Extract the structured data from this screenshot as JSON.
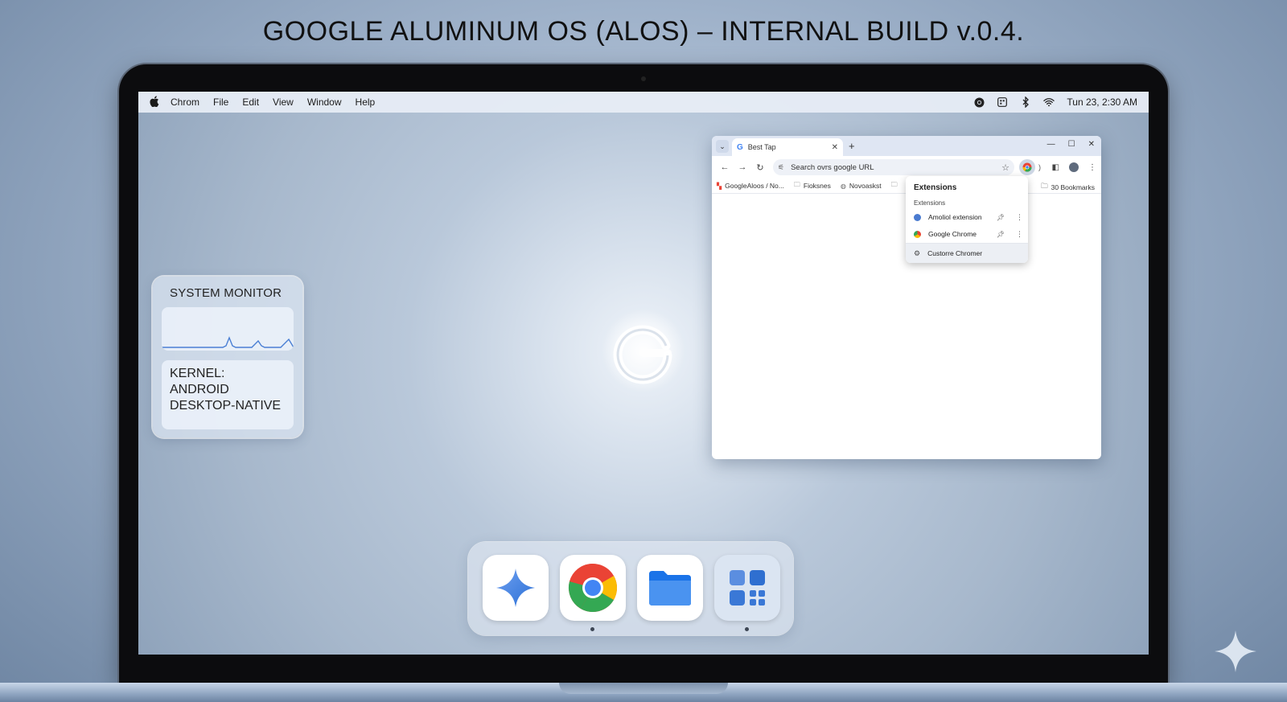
{
  "page": {
    "title": "GOOGLE ALUMINUM OS (ALOS) – INTERNAL BUILD v.0.4."
  },
  "menubar": {
    "app_name": "Chrom",
    "items": [
      "File",
      "Edit",
      "View",
      "Window",
      "Help"
    ],
    "tray_icons": [
      "chrome-icon",
      "grid-square-icon",
      "bluetooth-icon",
      "wifi-icon"
    ],
    "clock": "Tun 23, 2:30 AM"
  },
  "widget": {
    "title": "SYSTEM MONITOR",
    "kernel_lines": [
      "KERNEL:",
      "ANDROID",
      "DESKTOP-NATIVE"
    ]
  },
  "browser": {
    "tab_title": "Best Tap",
    "omnibox_text": "Search ovrs google URL",
    "bookmarks": [
      {
        "label": "GoogleAloos / No...",
        "icon": "google-favicon-icon"
      },
      {
        "label": "Fioksnes",
        "icon": "folder-icon"
      },
      {
        "label": "Novoaskst",
        "icon": "globe-icon"
      }
    ],
    "all_bookmarks": "30 Bookmarks",
    "extensions_popup": {
      "title": "Extensions",
      "subtitle": "Extensions",
      "items": [
        {
          "label": "Amoliol extension",
          "icon_color": "#4a7bd0"
        },
        {
          "label": "Google Chrome",
          "icon_color": "#e94235"
        }
      ],
      "manage_label": "Custorre Chromer"
    }
  },
  "dock": {
    "apps": [
      {
        "name": "Gemini",
        "icon": "gemini-sparkle-icon",
        "running": false
      },
      {
        "name": "Chrome",
        "icon": "chrome-icon",
        "running": true
      },
      {
        "name": "Files",
        "icon": "folder-icon",
        "running": false
      },
      {
        "name": "App Launcher",
        "icon": "app-grid-icon",
        "running": true
      }
    ]
  },
  "colors": {
    "accent_blue": "#4285f4",
    "chrome_red": "#ea4335",
    "chrome_yellow": "#fbbc05",
    "chrome_green": "#34a853"
  }
}
